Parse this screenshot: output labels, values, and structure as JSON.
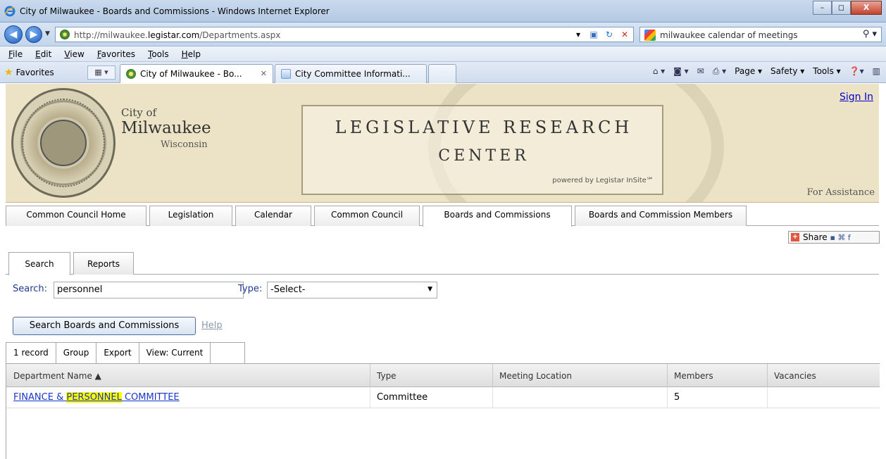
{
  "window": {
    "title": "City of Milwaukee - Boards and Commissions - Windows Internet Explorer",
    "minimize": "–",
    "maximize": "◻",
    "close": "X"
  },
  "address": {
    "url_prefix": "http://milwaukee.",
    "url_domain": "legistar.com",
    "url_suffix": "/Departments.aspx",
    "search_text": "milwaukee calendar of meetings"
  },
  "menu": [
    "File",
    "Edit",
    "View",
    "Favorites",
    "Tools",
    "Help"
  ],
  "favorites_label": "Favorites",
  "browser_tabs": {
    "active": "City of Milwaukee - Bo...",
    "other": "City Committee Informati..."
  },
  "command_bar": {
    "page": "Page ▾",
    "safety": "Safety ▾",
    "tools": "Tools ▾"
  },
  "banner": {
    "city_of": "City of",
    "city_name": "Milwaukee",
    "state": "Wisconsin",
    "title_line1": "LEGISLATIVE RESEARCH",
    "title_line2": "CENTER",
    "powered_by": "powered by Legistar InSite℠",
    "sign_in": "Sign In",
    "assistance": "For Assistance"
  },
  "main_tabs": [
    "Common Council Home",
    "Legislation",
    "Calendar",
    "Common Council",
    "Boards and Commissions",
    "Boards and Commission Members"
  ],
  "share_label": "Share",
  "sub_tabs": [
    "Search",
    "Reports"
  ],
  "search": {
    "label": "Search:",
    "value": "personnel",
    "type_label": "Type:",
    "type_selected": "-Select-",
    "button": "Search Boards and Commissions",
    "help": "Help"
  },
  "grid_toolbar": [
    "1 record",
    "Group",
    "Export",
    "View: Current"
  ],
  "columns": [
    "Department Name ▲",
    "Type",
    "Meeting Location",
    "Members",
    "Vacancies"
  ],
  "rows": [
    {
      "name_pre": "FINANCE & ",
      "name_highlight": "PERSONNEL",
      "name_post": " COMMITTEE",
      "type": "Committee",
      "location": "",
      "members": "5",
      "vacancies": ""
    }
  ],
  "colors": {
    "link": "#1a35c8",
    "highlight": "#ffff00",
    "label_blue": "#1d3b8f",
    "banner_bg": "#ece3c6"
  }
}
